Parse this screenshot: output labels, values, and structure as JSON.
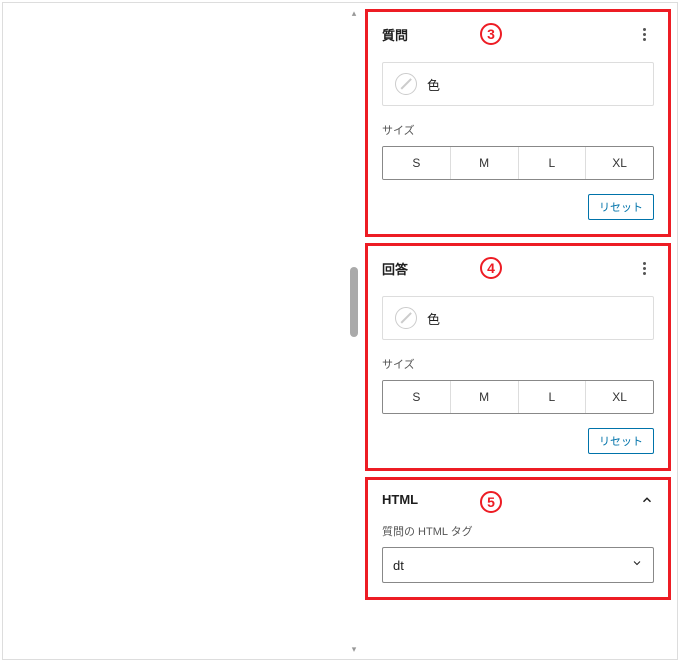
{
  "panels": {
    "question": {
      "title": "質問",
      "marker": "3",
      "color_label": "色",
      "size_label": "サイズ",
      "sizes": [
        "S",
        "M",
        "L",
        "XL"
      ],
      "reset": "リセット"
    },
    "answer": {
      "title": "回答",
      "marker": "4",
      "color_label": "色",
      "size_label": "サイズ",
      "sizes": [
        "S",
        "M",
        "L",
        "XL"
      ],
      "reset": "リセット"
    },
    "html": {
      "title": "HTML",
      "marker": "5",
      "field_label": "質問の HTML タグ",
      "select_value": "dt"
    }
  }
}
